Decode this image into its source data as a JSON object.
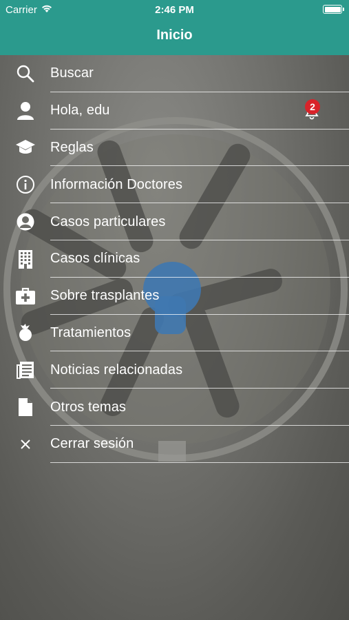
{
  "status_bar": {
    "carrier": "Carrier",
    "time": "2:46 PM"
  },
  "header": {
    "title": "Inicio",
    "background_color": "#2b9a8d"
  },
  "menu": {
    "items": [
      {
        "label": "Buscar",
        "icon": "search-icon"
      },
      {
        "label": "Hola, edu",
        "icon": "user-icon",
        "badge": "2"
      },
      {
        "label": "Reglas",
        "icon": "graduation-cap-icon"
      },
      {
        "label": "Información Doctores",
        "icon": "info-icon"
      },
      {
        "label": "Casos particulares",
        "icon": "user-circle-icon"
      },
      {
        "label": "Casos clínicas",
        "icon": "building-icon"
      },
      {
        "label": "Sobre trasplantes",
        "icon": "medical-kit-icon"
      },
      {
        "label": "Tratamientos",
        "icon": "treatment-icon"
      },
      {
        "label": "Noticias relacionadas",
        "icon": "news-icon"
      },
      {
        "label": "Otros temas",
        "icon": "document-icon"
      },
      {
        "label": "Cerrar sesión",
        "icon": "close-icon"
      }
    ]
  }
}
